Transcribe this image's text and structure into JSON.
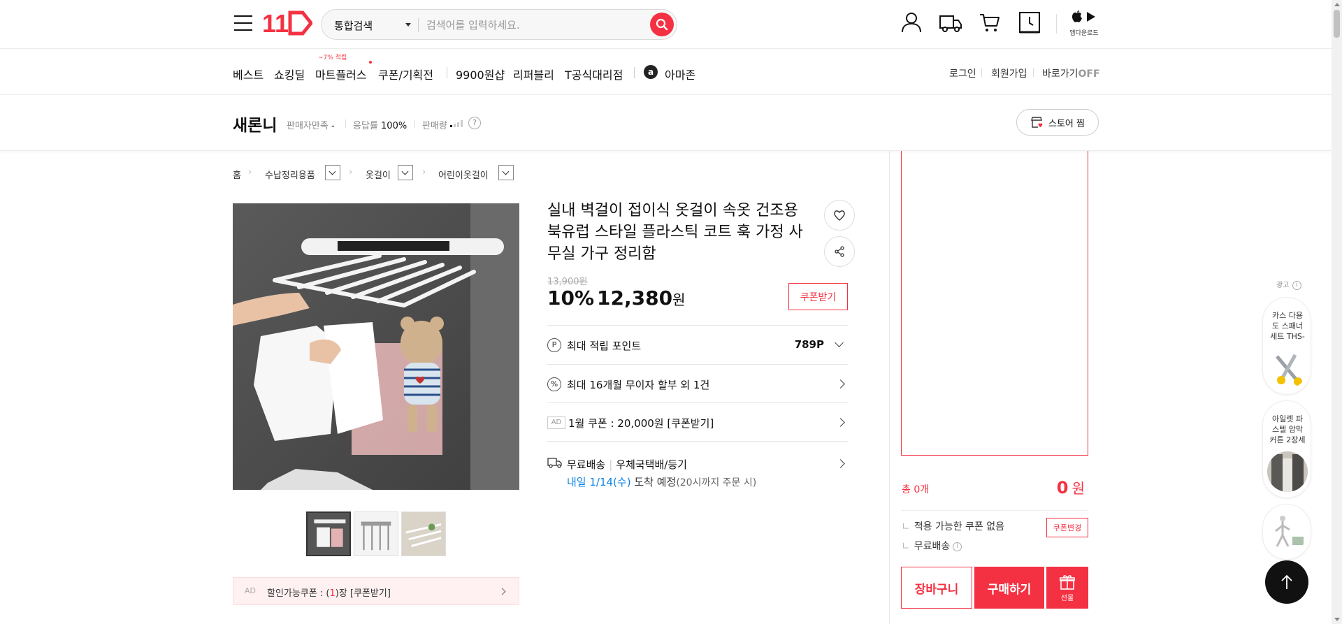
{
  "colors": {
    "accent": "#f43142",
    "ship_date_blue": "#0b83e6"
  },
  "header": {
    "logo_text": "11",
    "search": {
      "scope": "통합검색",
      "placeholder": "검색어를 입력하세요."
    },
    "icons": [
      "menu-icon",
      "search-icon",
      "user-icon",
      "truck-icon",
      "cart-icon",
      "recent-clock-icon",
      "apple-icon",
      "play-store-icon"
    ],
    "app_download_label": "앱다운로드"
  },
  "nav": {
    "items": [
      "베스트",
      "쇼킹딜",
      "마트플러스",
      "쿠폰/기획전",
      "9900원샵",
      "리퍼블리",
      "T공식대리점",
      "아마존"
    ],
    "mart_badge": "~7% 적립",
    "right": {
      "login": "로그인",
      "signup": "회원가입",
      "shortcut": "바로가기",
      "shortcut_state": "OFF"
    }
  },
  "seller": {
    "name": "새론니",
    "satisfaction_label": "판매자만족",
    "satisfaction_value": "-",
    "response_label": "응답률",
    "response_value": "100%",
    "sales_label": "판매량",
    "store_fav_label": "스토어 찜"
  },
  "breadcrumb": [
    "홈",
    "수납정리용품",
    "옷걸이",
    "어린이옷걸이"
  ],
  "product": {
    "title": "실내 벽걸이 접이식 옷걸이 속옷 건조용 북유럽 스타일 플라스틱 코트 훅 가정 사무실 가구 정리함",
    "original_price": "13,900원",
    "discount": "10%",
    "sale_price": "12,380",
    "won": "원",
    "coupon_button": "쿠폰받기",
    "points_label": "최대 적립 포인트",
    "points_value": "789P",
    "installment_label": "최대 16개월 무이자 할부 외 1건",
    "ad_tag": "AD",
    "january_coupon": "1월 쿠폰 : 20,000원 [쿠폰받기]",
    "shipping_label": "무료배송",
    "shipping_carrier": "우체국택배/등기",
    "delivery_date": "내일 1/14(수)",
    "delivery_suffix": "도착 예정",
    "delivery_note": "(20시까지 주문 시)",
    "ad_coupon_bar": {
      "ad": "AD",
      "prefix": "할인가능쿠폰 : (",
      "count": "1",
      "suffix": ")장 [쿠폰받기]"
    }
  },
  "order": {
    "total_count": "총 0개",
    "total_amount": "0",
    "won": "원",
    "coupon_none": "적용 가능한 쿠폰 없음",
    "coupon_change": "쿠폰변경",
    "free_shipping": "무료배송",
    "cart": "장바구니",
    "buy": "구매하기",
    "gift": "선물"
  },
  "ad_sidebar": {
    "label": "광고",
    "cards": [
      {
        "title": "카스 다용도 스패너 세트 THS-"
      },
      {
        "title": "아일렛 파스텔 암막 커튼 2장세"
      }
    ]
  }
}
